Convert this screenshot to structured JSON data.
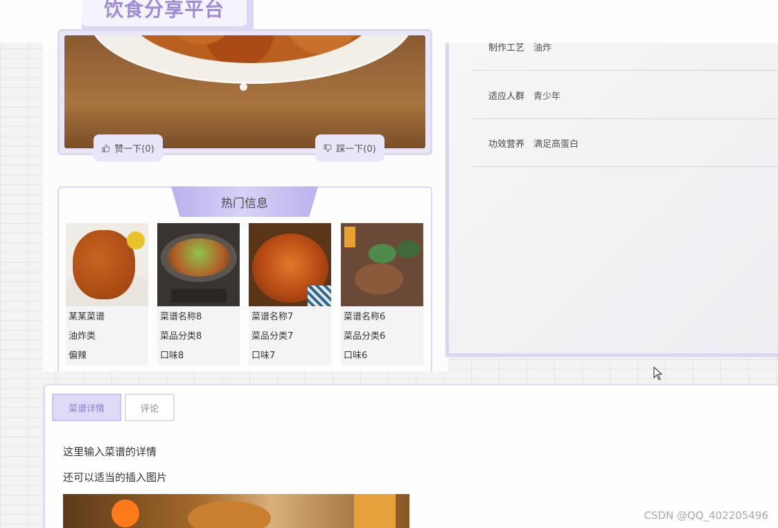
{
  "header": {
    "title": "饮食分享平台"
  },
  "vote": {
    "like_label": "赞一下(0)",
    "dislike_label": "踩一下(0)"
  },
  "hot": {
    "title": "热门信息",
    "items": [
      {
        "name": "某某菜谱",
        "category": "油炸类",
        "taste": "偏辣"
      },
      {
        "name": "菜谱名称8",
        "category": "菜品分类8",
        "taste": "口味8"
      },
      {
        "name": "菜谱名称7",
        "category": "菜品分类7",
        "taste": "口味7"
      },
      {
        "name": "菜谱名称6",
        "category": "菜品分类6",
        "taste": "口味6"
      }
    ]
  },
  "attributes": [
    {
      "key": "制作工艺",
      "value": "油炸"
    },
    {
      "key": "适应人群",
      "value": "青少年"
    },
    {
      "key": "功效营养",
      "value": "满足高蛋白"
    }
  ],
  "tabs": [
    {
      "label": "菜谱详情",
      "active": true
    },
    {
      "label": "评论",
      "active": false
    }
  ],
  "detail": {
    "line1": "这里输入菜谱的详情",
    "line2": "还可以适当的插入图片"
  },
  "watermark": "CSDN @QQ_402205496",
  "colors": {
    "accent": "#a08ad8",
    "panel_border": "#dad8f3",
    "tab_active_bg": "#dcdaf6"
  }
}
